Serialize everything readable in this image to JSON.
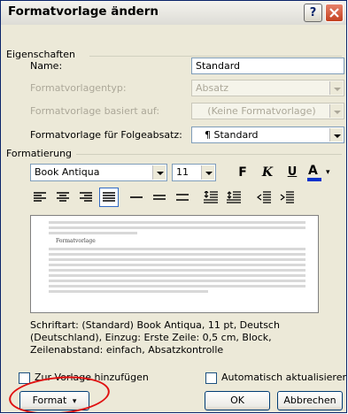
{
  "window": {
    "title": "Formatvorlage ändern",
    "help_label": "?"
  },
  "eigenschaften": {
    "group_label": "Eigenschaften",
    "name_label": "Name:",
    "name_value": "Standard",
    "type_label": "Formatvorlagentyp:",
    "type_value": "Absatz",
    "based_on_label": "Formatvorlage basiert auf:",
    "based_on_value": "(Keine Formatvorlage)",
    "next_label": "Formatvorlage für Folgeabsatz:",
    "next_value": "¶ Standard"
  },
  "formatierung": {
    "group_label": "Formatierung",
    "font_value": "Book Antiqua",
    "size_value": "11",
    "bold_label": "F",
    "italic_label": "K",
    "underline_label": "U",
    "color_label": "A"
  },
  "preview": {
    "sample_title": "Formatvorlage"
  },
  "description": "Schriftart: (Standard) Book Antiqua, 11 pt, Deutsch (Deutschland), Einzug: Erste Zeile: 0,5 cm, Block, Zeilenabstand: einfach, Absatzkontrolle",
  "options": {
    "add_template_label": "Zur Vorlage hinzufügen",
    "auto_update_label": "Automatisch aktualisieren"
  },
  "buttons": {
    "format_label": "Format",
    "ok_label": "OK",
    "cancel_label": "Abbrechen"
  },
  "colors": {
    "highlight": "#E01010",
    "title_blue": "#0A246A",
    "close_red": "#C3401F"
  }
}
